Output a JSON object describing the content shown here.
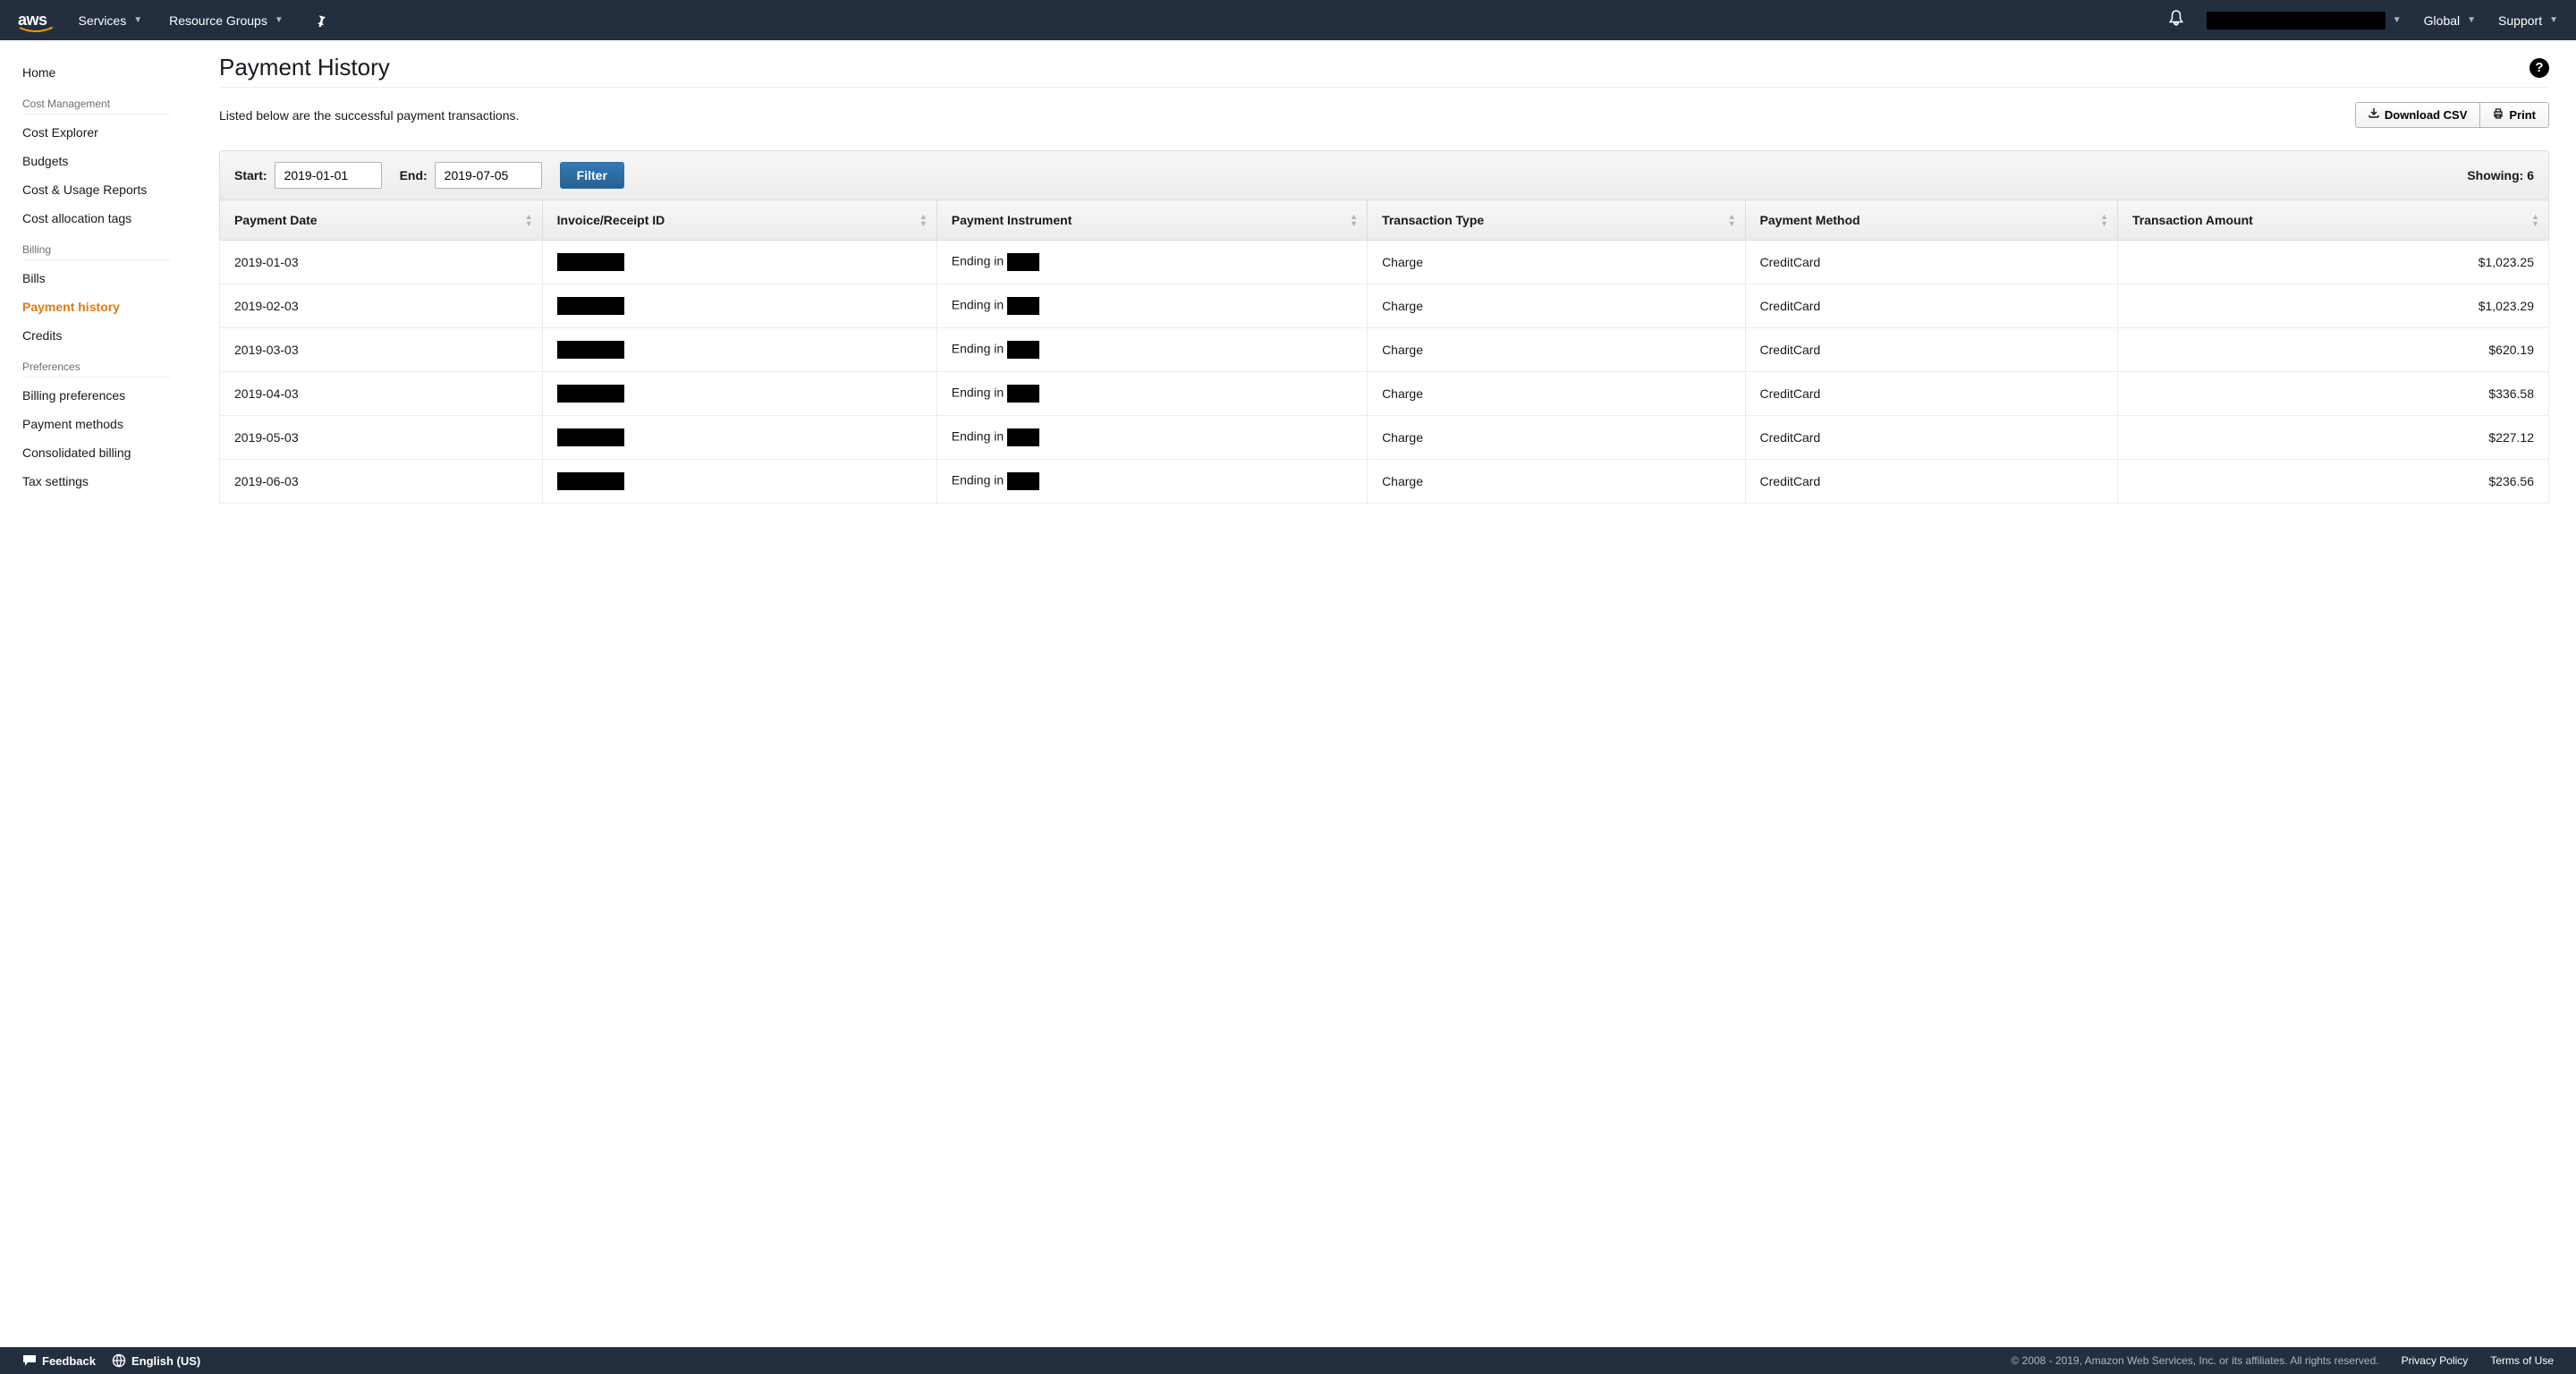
{
  "topbar": {
    "logo": "aws",
    "services": "Services",
    "resource_groups": "Resource Groups",
    "global": "Global",
    "support": "Support"
  },
  "sidebar": {
    "home": "Home",
    "sections": [
      {
        "heading": "Cost Management",
        "items": [
          "Cost Explorer",
          "Budgets",
          "Cost & Usage Reports",
          "Cost allocation tags"
        ]
      },
      {
        "heading": "Billing",
        "items": [
          "Bills",
          "Payment history",
          "Credits"
        ]
      },
      {
        "heading": "Preferences",
        "items": [
          "Billing preferences",
          "Payment methods",
          "Consolidated billing",
          "Tax settings"
        ]
      }
    ],
    "active": "Payment history"
  },
  "page": {
    "title": "Payment History",
    "subtitle": "Listed below are the successful payment transactions.",
    "download_csv": "Download CSV",
    "print": "Print"
  },
  "filter": {
    "start_label": "Start:",
    "start_value": "2019-01-01",
    "end_label": "End:",
    "end_value": "2019-07-05",
    "filter_btn": "Filter",
    "showing_label": "Showing:",
    "showing_count": "6"
  },
  "table": {
    "columns": [
      "Payment Date",
      "Invoice/Receipt ID",
      "Payment Instrument",
      "Transaction Type",
      "Payment Method",
      "Transaction Amount"
    ],
    "rows": [
      {
        "date": "2019-01-03",
        "instrument_prefix": "Ending in",
        "txn_type": "Charge",
        "method": "CreditCard",
        "amount": "$1,023.25"
      },
      {
        "date": "2019-02-03",
        "instrument_prefix": "Ending in",
        "txn_type": "Charge",
        "method": "CreditCard",
        "amount": "$1,023.29"
      },
      {
        "date": "2019-03-03",
        "instrument_prefix": "Ending in",
        "txn_type": "Charge",
        "method": "CreditCard",
        "amount": "$620.19"
      },
      {
        "date": "2019-04-03",
        "instrument_prefix": "Ending in",
        "txn_type": "Charge",
        "method": "CreditCard",
        "amount": "$336.58"
      },
      {
        "date": "2019-05-03",
        "instrument_prefix": "Ending in",
        "txn_type": "Charge",
        "method": "CreditCard",
        "amount": "$227.12"
      },
      {
        "date": "2019-06-03",
        "instrument_prefix": "Ending in",
        "txn_type": "Charge",
        "method": "CreditCard",
        "amount": "$236.56"
      }
    ]
  },
  "footer": {
    "feedback": "Feedback",
    "language": "English (US)",
    "copyright": "© 2008 - 2019, Amazon Web Services, Inc. or its affiliates. All rights reserved.",
    "privacy": "Privacy Policy",
    "terms": "Terms of Use"
  }
}
